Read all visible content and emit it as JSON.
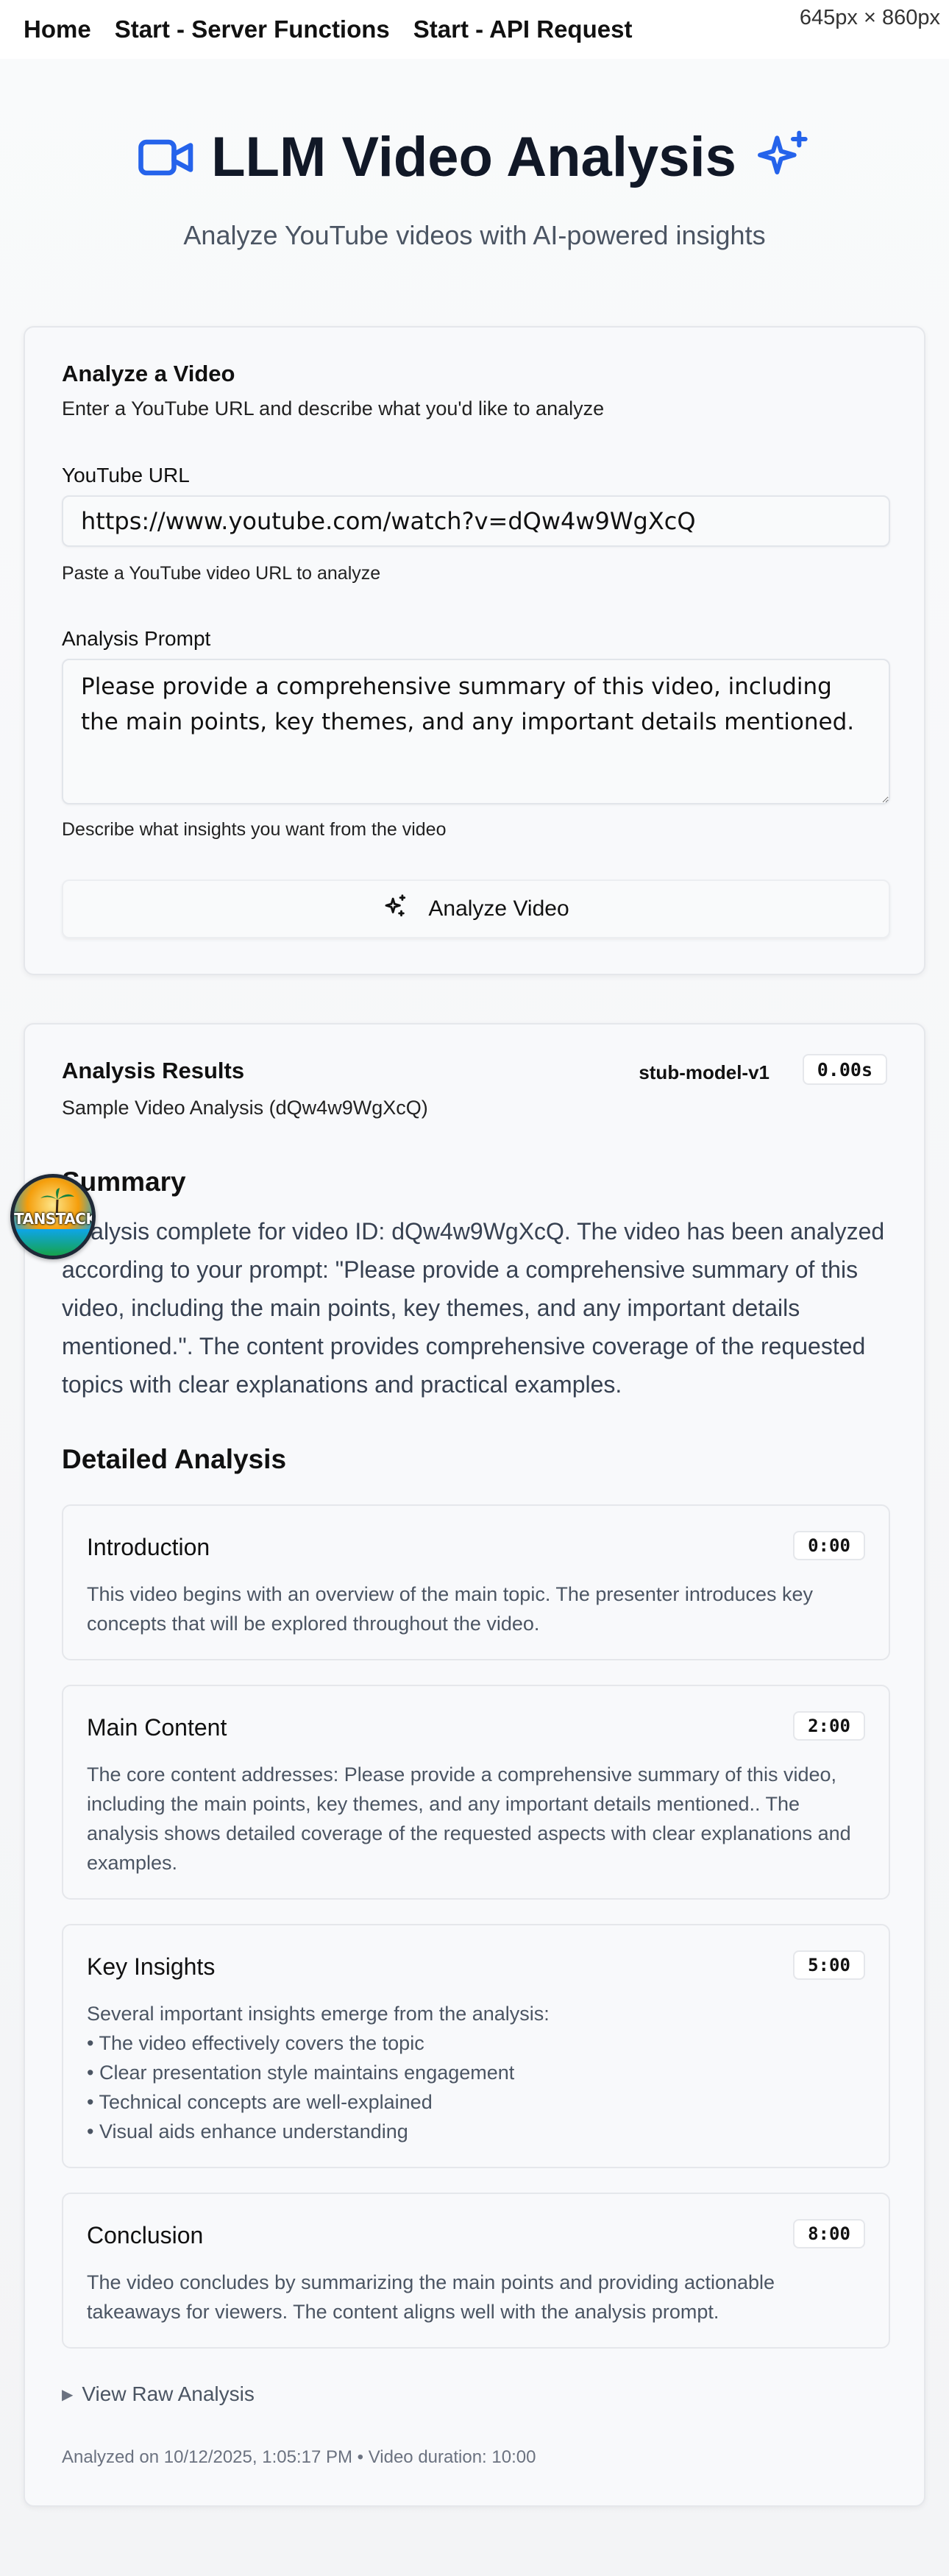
{
  "nav": {
    "home": "Home",
    "server_functions": "Start - Server Functions",
    "api_request": "Start - API Request"
  },
  "viewport_badge": "645px × 860px",
  "hero": {
    "title": "LLM Video Analysis",
    "subtitle": "Analyze YouTube videos with AI-powered insights",
    "accent_color": "#2563eb"
  },
  "form": {
    "title": "Analyze a Video",
    "subtitle": "Enter a YouTube URL and describe what you'd like to analyze",
    "url_label": "YouTube URL",
    "url_value": "https://www.youtube.com/watch?v=dQw4w9WgXcQ",
    "url_hint": "Paste a YouTube video URL to analyze",
    "prompt_label": "Analysis Prompt",
    "prompt_value": "Please provide a comprehensive summary of this video, including the main points, key themes, and any important details mentioned.",
    "prompt_hint": "Describe what insights you want from the video",
    "submit_label": "Analyze Video"
  },
  "results": {
    "title": "Analysis Results",
    "video_title": "Sample Video Analysis (dQw4w9WgXcQ)",
    "model": "stub-model-v1",
    "duration": "0.00s",
    "summary_heading": "Summary",
    "summary": "Analysis complete for video ID: dQw4w9WgXcQ. The video has been analyzed according to your prompt: \"Please provide a comprehensive summary of this video, including the main points, key themes, and any important details mentioned.\". The content provides comprehensive coverage of the requested topics with clear explanations and practical examples.",
    "detailed_heading": "Detailed Analysis",
    "segments": [
      {
        "title": "Introduction",
        "time": "0:00",
        "body": "This video begins with an overview of the main topic. The presenter introduces key concepts that will be explored throughout the video."
      },
      {
        "title": "Main Content",
        "time": "2:00",
        "body": "The core content addresses: Please provide a comprehensive summary of this video, including the main points, key themes, and any important details mentioned.. The analysis shows detailed coverage of the requested aspects with clear explanations and examples."
      },
      {
        "title": "Key Insights",
        "time": "5:00",
        "body": "Several important insights emerge from the analysis:\n• The video effectively covers the topic\n• Clear presentation style maintains engagement\n• Technical concepts are well-explained\n• Visual aids enhance understanding"
      },
      {
        "title": "Conclusion",
        "time": "8:00",
        "body": "The video concludes by summarizing the main points and providing actionable takeaways for viewers. The content aligns well with the analysis prompt."
      }
    ],
    "raw_toggle": "View Raw Analysis",
    "footer": "Analyzed on 10/12/2025, 1:05:17 PM • Video duration: 10:00"
  },
  "devtools_badge": {
    "label": "TANSTACK"
  }
}
